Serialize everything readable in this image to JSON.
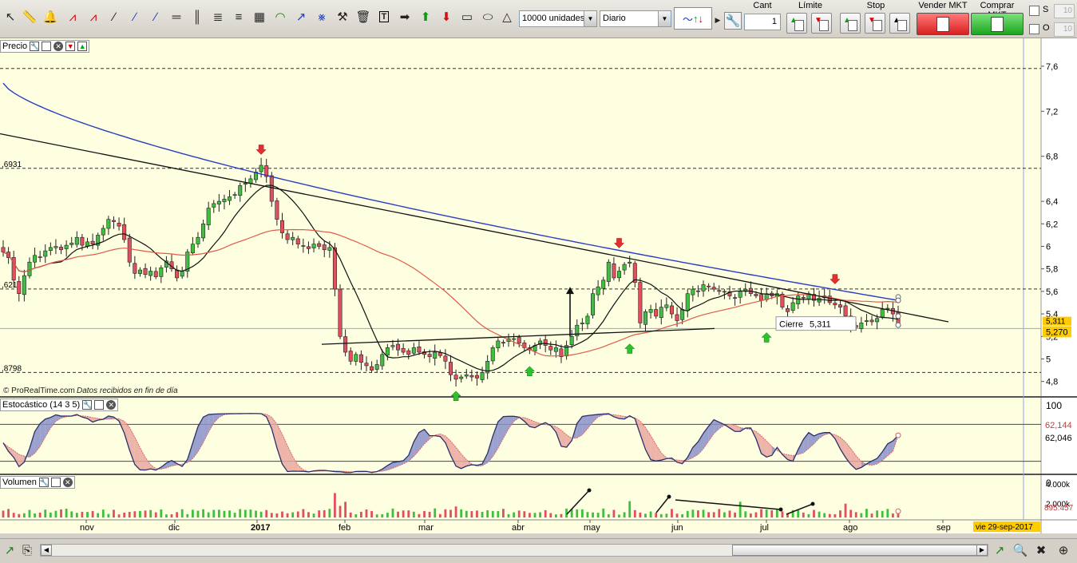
{
  "toolbar": {
    "quantity_select": "10000 unidades",
    "period_select": "Diario",
    "cant_label": "Cant",
    "cant_value": "1",
    "limite_label": "Límite",
    "stop_label": "Stop",
    "vender_label": "Vender MKT",
    "comprar_label": "Comprar MKT",
    "s_label": "S",
    "o_label": "O",
    "s_field": "10",
    "o_field": "10"
  },
  "panes": {
    "price_title": "Precio",
    "stoch_title": "Estocástico (14 3 5)",
    "volume_title": "Volumen",
    "watermark": "© ProRealTime.com",
    "watermark_note": "Datos recibidos en fin de día"
  },
  "price_scale": [
    "7,6",
    "7,2",
    "6,8",
    "6,4",
    "6,2",
    "6",
    "5,8",
    "5,6",
    "5,4",
    "5,2",
    "5",
    "4,8"
  ],
  "level_labels": [
    ",6931",
    ",621",
    ",8798"
  ],
  "price_badges": {
    "last_top": "5,311",
    "last_main": "5,270"
  },
  "tooltip": {
    "label": "Cierre",
    "value": "5,311"
  },
  "stoch_scale": {
    "top": "100",
    "bottom": "0",
    "k": "62,144",
    "d": "62,046"
  },
  "volume_scale": {
    "top": "4.000k",
    "mid": "2.000k",
    "last": "895.457"
  },
  "months": [
    "nov",
    "dic",
    "2017",
    "feb",
    "mar",
    "abr",
    "may",
    "jun",
    "jul",
    "ago",
    "sep"
  ],
  "date_badge": "vie 29-sep-2017",
  "colors": {
    "background": "#fefee0",
    "bull": "#3fbf3f",
    "bear": "#e05060",
    "ma200": "#2a3ec0",
    "ma50": "#e05a4a",
    "ma20": "#111111",
    "stoch_k": "#2b2f6b",
    "stoch_d": "#e06666",
    "last_price": "#ffcc00"
  },
  "chart_data": {
    "type": "candlestick",
    "price_range": [
      4.67,
      7.72
    ],
    "closes": [
      5.95,
      5.9,
      5.7,
      5.58,
      5.74,
      5.86,
      5.92,
      5.9,
      5.96,
      5.99,
      6.0,
      5.97,
      6.01,
      6.03,
      6.08,
      6.01,
      6.04,
      6.02,
      6.1,
      6.16,
      6.24,
      6.22,
      6.18,
      6.06,
      5.86,
      5.76,
      5.79,
      5.75,
      5.78,
      5.73,
      5.81,
      5.87,
      5.8,
      5.72,
      5.78,
      5.95,
      6.02,
      6.08,
      6.2,
      6.34,
      6.38,
      6.4,
      6.42,
      6.44,
      6.46,
      6.54,
      6.56,
      6.6,
      6.66,
      6.72,
      6.62,
      6.4,
      6.24,
      6.12,
      6.06,
      6.08,
      6.02,
      6.0,
      5.98,
      6.02,
      6.0,
      5.97,
      5.99,
      5.62,
      5.2,
      5.06,
      4.98,
      5.04,
      4.97,
      4.94,
      4.9,
      4.95,
      5.04,
      5.1,
      5.12,
      5.08,
      5.06,
      5.04,
      5.1,
      5.06,
      5.04,
      5.02,
      5.06,
      5.03,
      4.98,
      4.86,
      4.82,
      4.84,
      4.86,
      4.84,
      4.83,
      4.88,
      4.98,
      5.1,
      5.16,
      5.14,
      5.18,
      5.18,
      5.14,
      5.1,
      5.08,
      5.12,
      5.16,
      5.12,
      5.08,
      5.1,
      5.02,
      5.12,
      5.2,
      5.3,
      5.32,
      5.38,
      5.58,
      5.64,
      5.7,
      5.86,
      5.72,
      5.78,
      5.84,
      5.86,
      5.68,
      5.32,
      5.42,
      5.44,
      5.38,
      5.46,
      5.48,
      5.4,
      5.34,
      5.44,
      5.58,
      5.62,
      5.6,
      5.66,
      5.64,
      5.62,
      5.6,
      5.6,
      5.56,
      5.54,
      5.6,
      5.62,
      5.58,
      5.56,
      5.52,
      5.58,
      5.56,
      5.58,
      5.46,
      5.42,
      5.5,
      5.56,
      5.54,
      5.58,
      5.52,
      5.54,
      5.56,
      5.5,
      5.48,
      5.46,
      5.38,
      5.3,
      5.28,
      5.32,
      5.34,
      5.33,
      5.36,
      5.44,
      5.45,
      5.4,
      5.311
    ],
    "events": [
      {
        "type": "sell",
        "value": 6.83
      },
      {
        "type": "sell",
        "value": 6.0
      },
      {
        "type": "sell",
        "value": 5.68
      },
      {
        "type": "buy",
        "value": 4.7
      },
      {
        "type": "buy",
        "value": 4.92
      },
      {
        "type": "buy",
        "value": 5.12
      },
      {
        "type": "buy",
        "value": 5.22
      }
    ],
    "stochastic": {
      "k_last": 62.144,
      "d_last": 62.046
    },
    "volume_last": 895457
  }
}
